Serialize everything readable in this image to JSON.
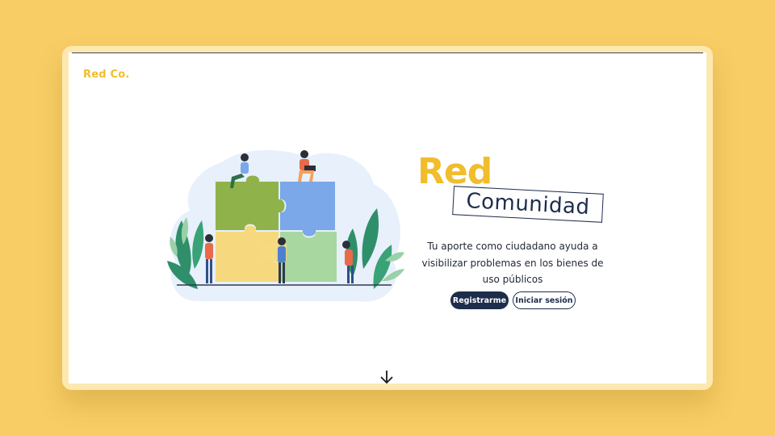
{
  "header": {
    "logo_text": "Red Co."
  },
  "hero": {
    "title_primary": "Red",
    "title_secondary": "Comunidad",
    "description": "Tu aporte como ciudadano ayuda a visibilizar problemas en los bienes de uso públicos",
    "register_button": "Registrarme",
    "login_button": "Iniciar sesión",
    "illustration_icon": "puzzle-teamwork-illustration",
    "scroll_icon": "arrow-down-icon"
  },
  "colors": {
    "background": "#f8cd65",
    "accent_yellow": "#f0bd2c",
    "navy": "#1d2d4c",
    "puzzle_green": "#8fb24a",
    "puzzle_blue": "#7aa8e8",
    "puzzle_yellow": "#f6d97f",
    "puzzle_mint": "#a8d7a0"
  }
}
